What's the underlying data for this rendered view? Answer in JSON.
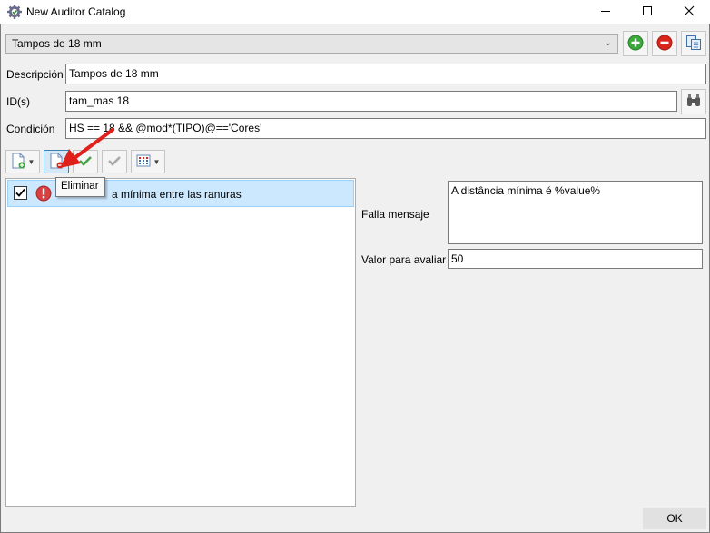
{
  "window": {
    "title": "New Auditor Catalog",
    "icon": "gear-check-icon",
    "controls": [
      "minimize-icon",
      "maximize-icon",
      "close-icon"
    ]
  },
  "catalog": {
    "selected": "Tampos de 18 mm",
    "actions": [
      "add-icon",
      "remove-icon",
      "copy-icon"
    ]
  },
  "form": {
    "descripcion_label": "Descripción",
    "descripcion_value": "Tampos de 18 mm",
    "ids_label": "ID(s)",
    "ids_value": "tam_mas 18",
    "condicion_label": "Condición",
    "condicion_value": "HS == 18 && @mod*(TIPO)@=='Cores'"
  },
  "toolbar": {
    "tooltip": "Eliminar"
  },
  "rules": [
    {
      "checked": true,
      "status": "error",
      "label": "a mínima entre las ranuras"
    }
  ],
  "details": {
    "falla_label": "Falla mensaje",
    "falla_value": "A distância mínima é %value%",
    "valor_label": "Valor para avaliar",
    "valor_value": "50"
  },
  "footer": {
    "ok_label": "OK"
  },
  "colors": {
    "selection": "#cce8ff",
    "selection_border": "#99d1ff",
    "add_green": "#3aa93a",
    "remove_red": "#d9261c",
    "arrow_red": "#e0201b",
    "check_green": "#47a347"
  }
}
